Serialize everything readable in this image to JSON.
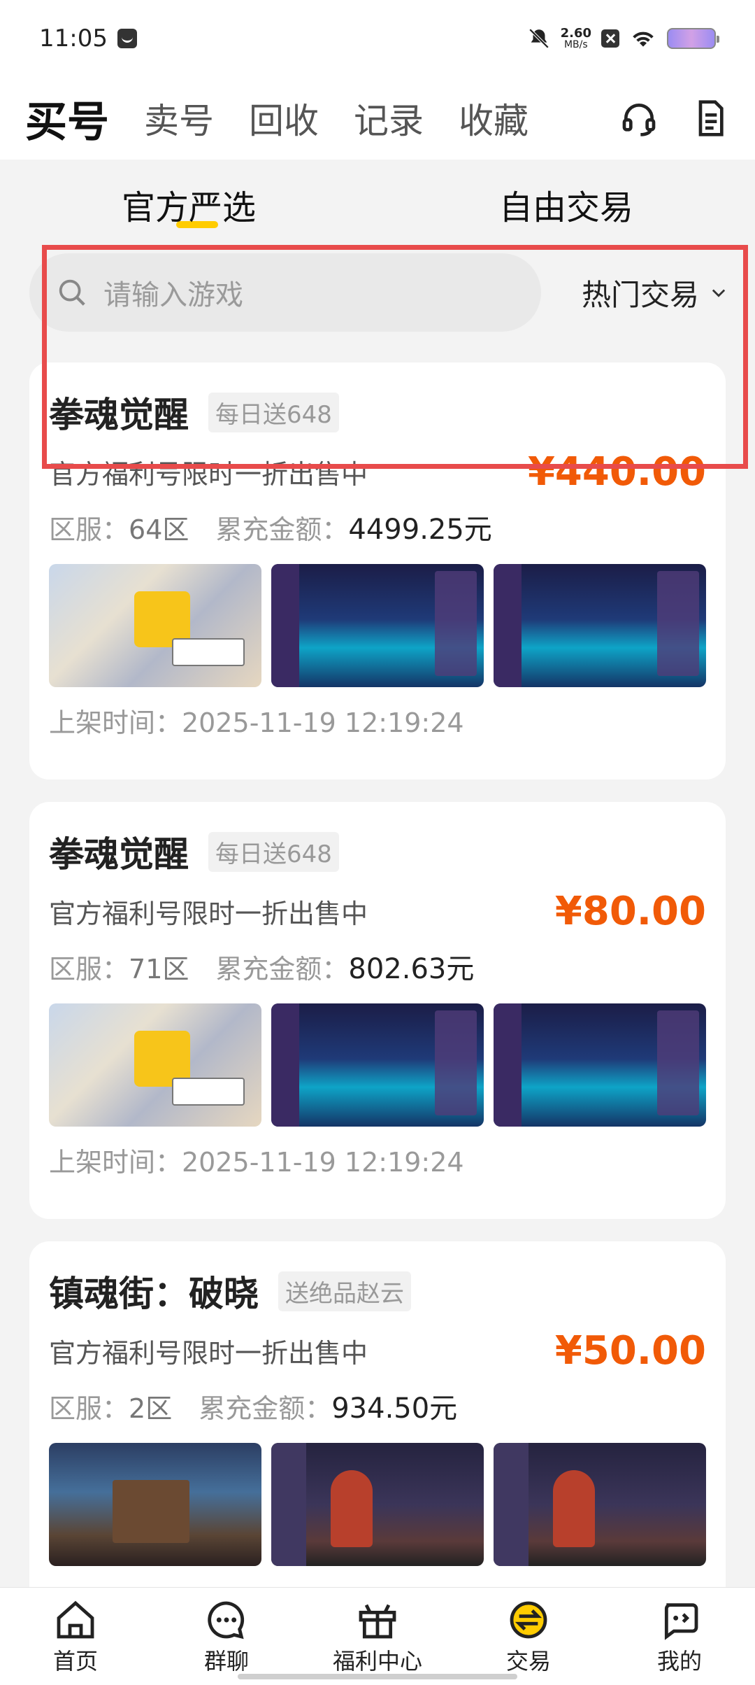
{
  "status_bar": {
    "time": "11:05",
    "net_speed_value": "2.60",
    "net_speed_unit": "MB/s"
  },
  "top_tabs": [
    "买号",
    "卖号",
    "回收",
    "记录",
    "收藏"
  ],
  "segments": [
    "官方严选",
    "自由交易"
  ],
  "search": {
    "placeholder": "请输入游戏"
  },
  "sort": {
    "label": "热门交易"
  },
  "listings": [
    {
      "title": "拳魂觉醒",
      "tag": "每日送648",
      "subtitle": "官方福利号限时一折出售中",
      "price": "¥440.00",
      "server_label": "区服：",
      "server": "64区",
      "recharge_label": "累充金额：",
      "recharge": "4499.25元",
      "time": "上架时间：2025-11-19 12:19:24"
    },
    {
      "title": "拳魂觉醒",
      "tag": "每日送648",
      "subtitle": "官方福利号限时一折出售中",
      "price": "¥80.00",
      "server_label": "区服：",
      "server": "71区",
      "recharge_label": "累充金额：",
      "recharge": "802.63元",
      "time": "上架时间：2025-11-19 12:19:24"
    },
    {
      "title": "镇魂街：破晓",
      "tag": "送绝品赵云",
      "subtitle": "官方福利号限时一折出售中",
      "price": "¥50.00",
      "server_label": "区服：",
      "server": "2区",
      "recharge_label": "累充金额：",
      "recharge": "934.50元"
    }
  ],
  "bottom_nav": [
    {
      "label": "首页",
      "icon": "home-icon"
    },
    {
      "label": "群聊",
      "icon": "chat-icon"
    },
    {
      "label": "福利中心",
      "icon": "gift-icon"
    },
    {
      "label": "交易",
      "icon": "trade-icon"
    },
    {
      "label": "我的",
      "icon": "profile-icon"
    }
  ],
  "colors": {
    "accent_yellow": "#ffcc00",
    "price_orange": "#f15a07",
    "highlight_red": "#e84b4b"
  }
}
